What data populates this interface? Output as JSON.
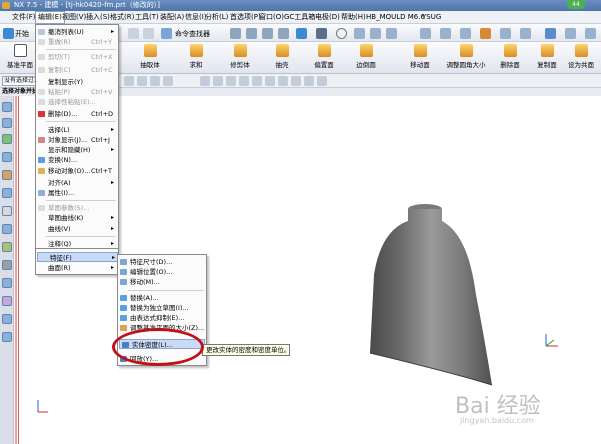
{
  "window": {
    "title": "NX 7.5 - 建模 - [tj-hk0420-fm.prt（修改的）]",
    "badge": "44"
  },
  "menubar": [
    "文件(F)",
    "编辑(E)",
    "视图(V)",
    "插入(S)",
    "格式(R)",
    "工具(T)",
    "装配(A)",
    "信息(I)",
    "分析(L)",
    "首选项(P)",
    "窗口(O)",
    "GC工具箱",
    "电极(D)",
    "帮助(H)",
    "HB_MOULD M6.6",
    "YSUG"
  ],
  "toolbar": {
    "start": "开始",
    "cmd_finder": "命令查找器"
  },
  "ribbon": [
    "基准平面",
    "抽取体",
    "求和",
    "修剪体",
    "抽壳",
    "偏置面",
    "边倒圆",
    "移动面",
    "调整圆角大小",
    "删除面",
    "复制面",
    "设为共面"
  ],
  "selection": {
    "filter": "没有选择过滤器",
    "label": "选择对象并执行"
  },
  "edit_menu": {
    "items": [
      {
        "label": "撤消列表(U)",
        "shortcut": "",
        "arrow": true,
        "disabled": false
      },
      {
        "label": "重做(R)",
        "shortcut": "Ctrl+Y",
        "arrow": false,
        "disabled": true
      },
      {
        "label": "剪切(T)",
        "shortcut": "Ctrl+X",
        "arrow": false,
        "disabled": true
      },
      {
        "label": "复制(C)",
        "shortcut": "Ctrl+C",
        "arrow": false,
        "disabled": true
      },
      {
        "label": "复制显示(Y)",
        "shortcut": "",
        "arrow": false,
        "disabled": false
      },
      {
        "label": "粘贴(P)",
        "shortcut": "Ctrl+V",
        "arrow": false,
        "disabled": true
      },
      {
        "label": "选择性粘贴(E)...",
        "shortcut": "",
        "arrow": false,
        "disabled": true
      },
      {
        "label": "删除(D)...",
        "shortcut": "Ctrl+D",
        "arrow": false,
        "disabled": false
      },
      {
        "label": "选择(L)",
        "shortcut": "",
        "arrow": true,
        "disabled": false
      },
      {
        "label": "对象显示(J)...",
        "shortcut": "Ctrl+J",
        "arrow": false,
        "disabled": false
      },
      {
        "label": "显示和隐藏(H)",
        "shortcut": "",
        "arrow": true,
        "disabled": false
      },
      {
        "label": "变换(N)...",
        "shortcut": "",
        "arrow": false,
        "disabled": false
      },
      {
        "label": "移动对象(O)...",
        "shortcut": "Ctrl+T",
        "arrow": false,
        "disabled": false
      },
      {
        "label": "对齐(A)",
        "shortcut": "",
        "arrow": true,
        "disabled": false
      },
      {
        "label": "属性(I)...",
        "shortcut": "",
        "arrow": false,
        "disabled": false
      },
      {
        "label": "草图参数(S)...",
        "shortcut": "",
        "arrow": false,
        "disabled": true
      },
      {
        "label": "草图曲线(K)",
        "shortcut": "",
        "arrow": true,
        "disabled": false
      },
      {
        "label": "曲线(V)",
        "shortcut": "",
        "arrow": true,
        "disabled": false
      },
      {
        "label": "注释(Q)",
        "shortcut": "",
        "arrow": true,
        "disabled": false
      },
      {
        "label": "特征(F)",
        "shortcut": "",
        "arrow": true,
        "disabled": false
      },
      {
        "label": "曲面(R)",
        "shortcut": "",
        "arrow": true,
        "disabled": false
      }
    ]
  },
  "feature_submenu": {
    "items": [
      {
        "label": "特征尺寸(D)..."
      },
      {
        "label": "编辑位置(O)..."
      },
      {
        "label": "移动(M)..."
      },
      {
        "label": "替换(A)..."
      },
      {
        "label": "替换为独立草图(I)..."
      },
      {
        "label": "由表达式抑制(E)..."
      },
      {
        "label": "调整基准平面的大小(Z)..."
      },
      {
        "label": "实体密度(L)..."
      },
      {
        "label": "回放(Y)..."
      }
    ]
  },
  "tooltip": "更改实体的密度和密度单位。",
  "watermark": {
    "brand": "Bai 经验",
    "sub": "jingyan.baidu.com"
  },
  "colors": {
    "highlight_ring": "#c01018",
    "menu_highlight": "#c9daf4"
  }
}
